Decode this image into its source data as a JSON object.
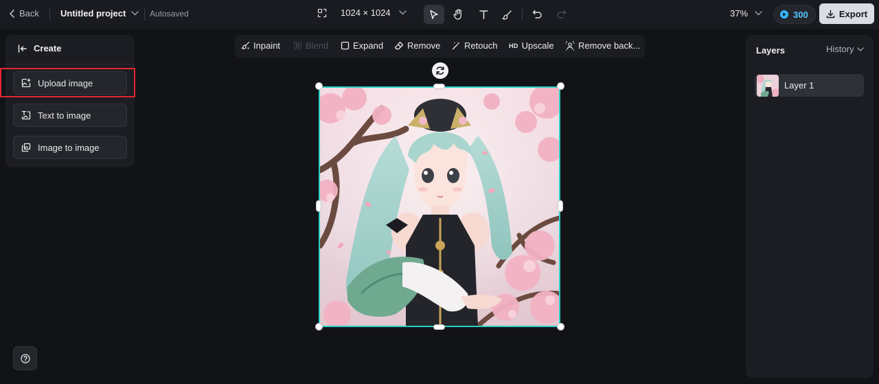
{
  "topbar": {
    "back_label": "Back",
    "project_name": "Untitled project",
    "save_status": "Autosaved",
    "canvas_size": "1024 × 1024",
    "zoom_level": "37%",
    "credits": "300",
    "export_label": "Export"
  },
  "left_panel": {
    "header": "Create",
    "items": [
      {
        "label": "Upload image",
        "icon": "upload-image-icon"
      },
      {
        "label": "Text to image",
        "icon": "text-to-image-icon"
      },
      {
        "label": "Image to image",
        "icon": "image-to-image-icon"
      }
    ]
  },
  "edit_toolbar": {
    "items": [
      {
        "label": "Inpaint",
        "enabled": true
      },
      {
        "label": "Blend",
        "enabled": false
      },
      {
        "label": "Expand",
        "enabled": true
      },
      {
        "label": "Remove",
        "enabled": true
      },
      {
        "label": "Retouch",
        "enabled": true
      },
      {
        "label": "Upscale",
        "badge": "HD",
        "enabled": true
      },
      {
        "label": "Remove back...",
        "enabled": true
      }
    ]
  },
  "right_panel": {
    "title": "Layers",
    "history_label": "History",
    "layers": [
      {
        "name": "Layer 1"
      }
    ]
  },
  "colors": {
    "accent_selection": "#2ad0c6",
    "highlight_box": "#e5262d",
    "credits_text": "#53c7ff"
  }
}
